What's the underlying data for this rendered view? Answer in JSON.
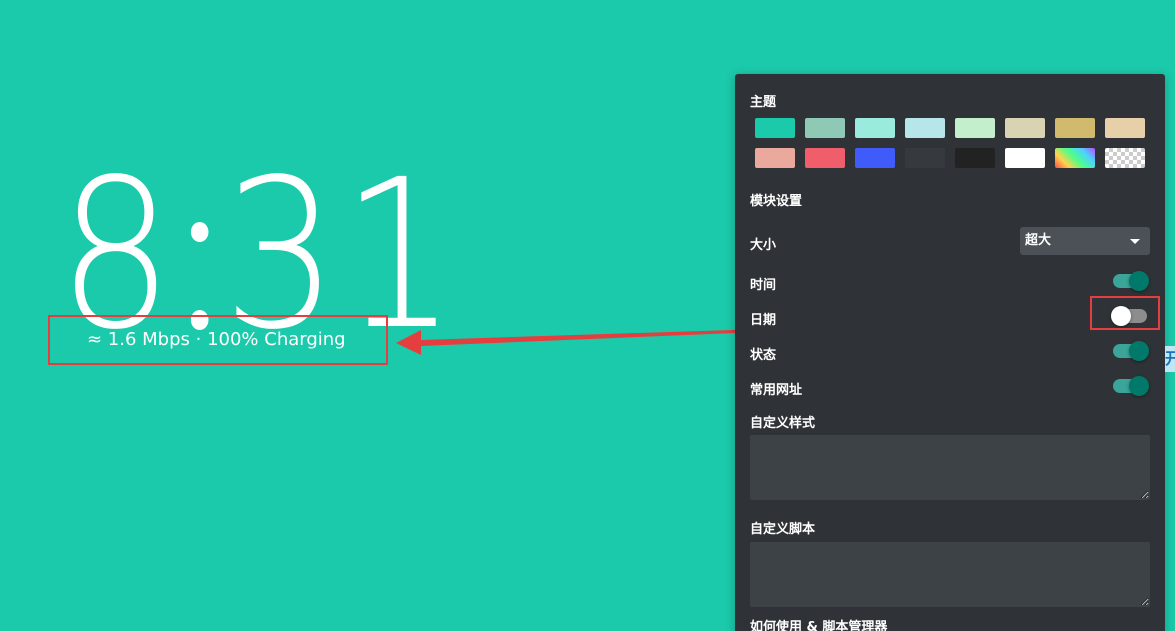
{
  "clock": {
    "hour": "8",
    "minute": "31"
  },
  "status": {
    "text": "≈ 1.6 Mbps · 100% Charging"
  },
  "panel": {
    "theme_label": "主题",
    "theme_swatches": [
      {
        "color": "#1bcaaa",
        "type": "solid"
      },
      {
        "color": "#8fc9b5",
        "type": "solid"
      },
      {
        "color": "#9aeadd",
        "type": "solid"
      },
      {
        "color": "#b6e6ea",
        "type": "solid"
      },
      {
        "color": "#c4efcc",
        "type": "solid"
      },
      {
        "color": "#d9d3b4",
        "type": "solid"
      },
      {
        "color": "#d1b96d",
        "type": "solid"
      },
      {
        "color": "#e7cfaa",
        "type": "solid"
      },
      {
        "color": "#eaa99c",
        "type": "solid"
      },
      {
        "color": "#f05d6b",
        "type": "solid"
      },
      {
        "color": "#3f5bfa",
        "type": "solid"
      },
      {
        "color": "#36393d",
        "type": "solid"
      },
      {
        "color": "#222222",
        "type": "solid"
      },
      {
        "color": "#ffffff",
        "type": "solid"
      },
      {
        "color": "rainbow",
        "type": "gradient"
      },
      {
        "color": "transparent",
        "type": "checker"
      }
    ],
    "module_settings_label": "模块设置",
    "size": {
      "label": "大小",
      "selected": "超大"
    },
    "toggles": {
      "time": {
        "label": "时间",
        "on": true
      },
      "date": {
        "label": "日期",
        "on": false
      },
      "status": {
        "label": "状态",
        "on": true
      },
      "common_urls": {
        "label": "常用网址",
        "on": true
      }
    },
    "custom_style": {
      "label": "自定义样式",
      "value": ""
    },
    "custom_script": {
      "label": "自定义脚本",
      "value": ""
    },
    "help_label": "如何使用 & 脚本管理器"
  },
  "edge_tab": {
    "text": "开"
  },
  "annotation_color": "#e53e3e"
}
